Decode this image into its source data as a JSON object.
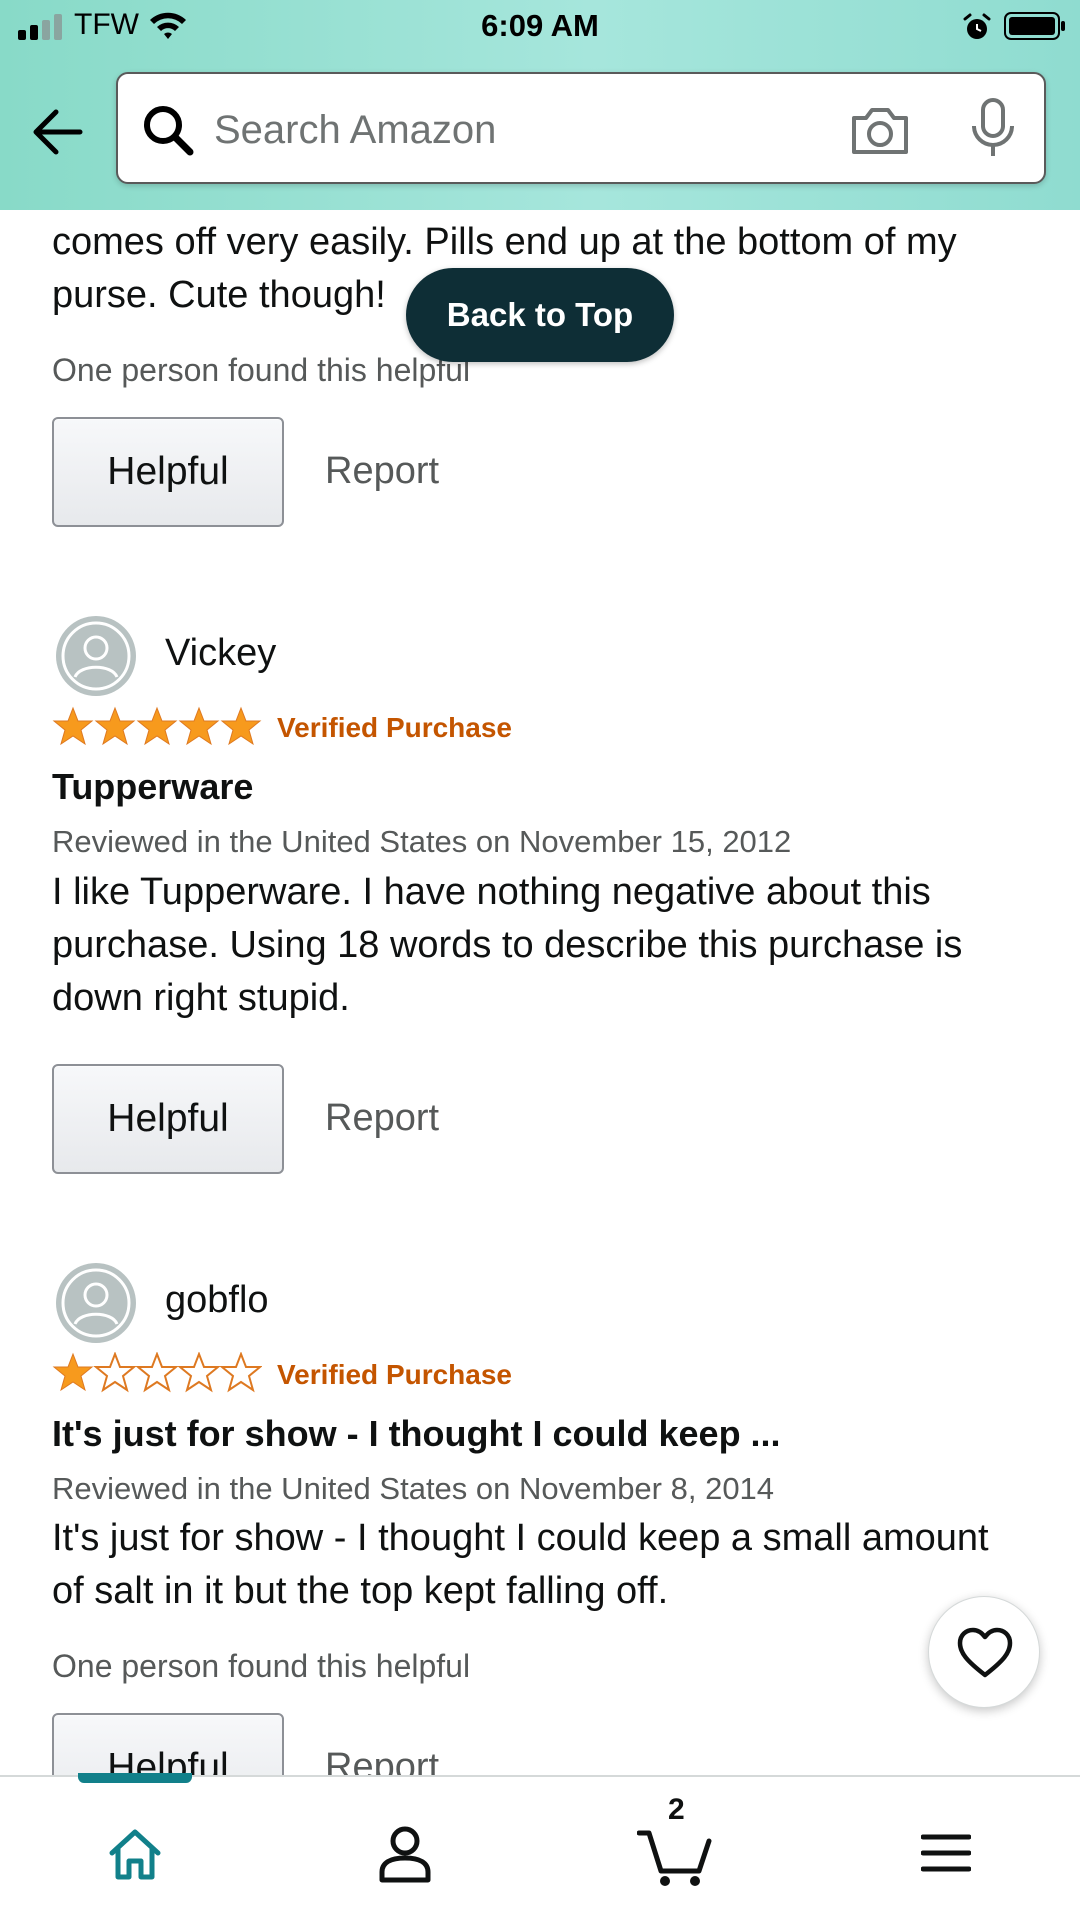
{
  "status_bar": {
    "carrier": "TFW",
    "time": "6:09 AM"
  },
  "search": {
    "placeholder": "Search Amazon"
  },
  "floating": {
    "back_to_top": "Back to Top"
  },
  "reviews": [
    {
      "body": "comes off very easily. Pills end up at the bottom of my purse. Cute though!",
      "helpful_count": "One person found this helpful",
      "helpful_label": "Helpful",
      "report_label": "Report"
    },
    {
      "reviewer": "Vickey",
      "rating": 5,
      "verified": "Verified Purchase",
      "title": "Tupperware",
      "date": "Reviewed in the United States on November 15, 2012",
      "body": "I like Tupperware. I have nothing negative about this purchase. Using 18 words to describe this purchase is down right stupid.",
      "helpful_label": "Helpful",
      "report_label": "Report"
    },
    {
      "reviewer": "gobflo",
      "rating": 1,
      "verified": "Verified Purchase",
      "title": "It's just for show - I thought I could keep ...",
      "date": "Reviewed in the United States on November 8, 2014",
      "body": "It's just for show - I thought I could keep a small amount of salt in it but the top kept falling off.",
      "helpful_count": "One person found this helpful",
      "helpful_label": "Helpful",
      "report_label": "Report"
    }
  ],
  "bottom_nav": {
    "cart_count": "2",
    "active": "home"
  },
  "colors": {
    "header": "#a6e6dc",
    "verified": "#c45500",
    "star": "#f79a1d",
    "accent": "#11808a",
    "back_to_top": "#0e2e36"
  }
}
